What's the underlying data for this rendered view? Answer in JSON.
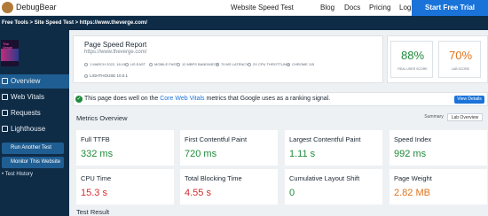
{
  "header": {
    "brand": "DebugBear",
    "nav": [
      "Website Speed Test",
      "Blog",
      "Docs",
      "Pricing",
      "Log In"
    ],
    "cta": "Start Free Trial"
  },
  "breadcrumb": "Free Tools > Site Speed Test > https://www.theverge.com/",
  "sidebar": {
    "thumb_text": "The Verge",
    "items": [
      "Overview",
      "Web Vitals",
      "Requests",
      "Lighthouse"
    ],
    "buttons": [
      "Run Another Test",
      "Monitor This Website"
    ],
    "link": "Test History"
  },
  "report": {
    "title": "Page Speed Report",
    "url": "https://www.theverge.com/",
    "meta": [
      "1 MARCH 2022, 16:19",
      "US EAST",
      "MOBILE FAST",
      "12 MBPS BANDWIDTH",
      "70 MS LATENCY",
      "2X CPU THROTTLING",
      "CHROME 115"
    ],
    "lighthouse": "LIGHTHOUSE 10.0.1",
    "scores": [
      {
        "value": "88%",
        "label": "REAL USER SCORE",
        "color": "#1f8a3a"
      },
      {
        "value": "70%",
        "label": "LAB SCORE",
        "color": "#e0731a"
      }
    ]
  },
  "banner": {
    "prefix": "This page does well on the",
    "link": "Core Web Vitals",
    "suffix": "metrics that Google uses as a ranking signal.",
    "button": "View Details"
  },
  "metrics_overview": {
    "title": "Metrics Overview",
    "toggle": [
      "Summary",
      "Lab Overview"
    ],
    "items": [
      {
        "label": "Full TTFB",
        "value": "332 ms",
        "status": "green"
      },
      {
        "label": "First Contentful Paint",
        "value": "720 ms",
        "status": "green"
      },
      {
        "label": "Largest Contentful Paint",
        "value": "1.11 s",
        "status": "green"
      },
      {
        "label": "Speed Index",
        "value": "992 ms",
        "status": "green"
      },
      {
        "label": "CPU Time",
        "value": "15.3 s",
        "status": "red"
      },
      {
        "label": "Total Blocking Time",
        "value": "4.55 s",
        "status": "red"
      },
      {
        "label": "Cumulative Layout Shift",
        "value": "0",
        "status": "green"
      },
      {
        "label": "Page Weight",
        "value": "2.82 MB",
        "status": "orange"
      }
    ]
  },
  "test_result": {
    "title": "Test Result"
  }
}
